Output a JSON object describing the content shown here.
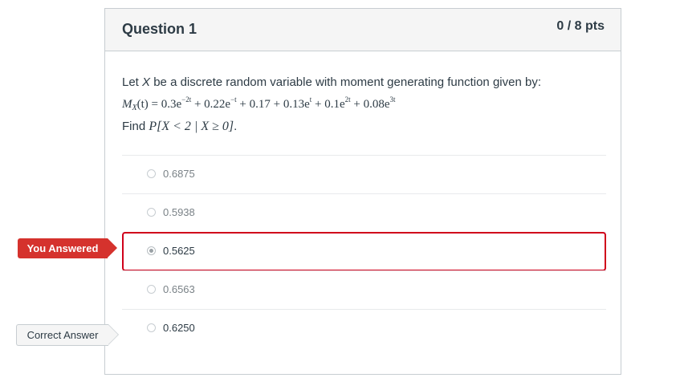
{
  "question": {
    "title": "Question 1",
    "points": "0 / 8 pts",
    "text_prefix": "Let ",
    "text_var": "X",
    "text_suffix": " be a discrete random variable with moment generating function given by:",
    "mgf_lhs": "M",
    "mgf_sub": "X",
    "mgf_arg": "(t) = 0.3e",
    "mgf_exp1": "−2t",
    "mgf_t2": " + 0.22e",
    "mgf_exp2": "−t",
    "mgf_t3": " + 0.17 + 0.13e",
    "mgf_exp3": "t",
    "mgf_t4": " + 0.1e",
    "mgf_exp4": "2t",
    "mgf_t5": " + 0.08e",
    "mgf_exp5": "3t",
    "find_label": "Find ",
    "find_expr": "P[X < 2 | X ≥ 0]",
    "find_end": "."
  },
  "answers": [
    {
      "label": "0.6875"
    },
    {
      "label": "0.5938"
    },
    {
      "label": "0.5625"
    },
    {
      "label": "0.6563"
    },
    {
      "label": "0.6250"
    }
  ],
  "flags": {
    "you_answered": "You Answered",
    "correct_answer": "Correct Answer"
  },
  "colors": {
    "wrong_border": "#d0021b",
    "you_answered_flag": "#d5322d",
    "header_bg": "#f5f5f5"
  }
}
